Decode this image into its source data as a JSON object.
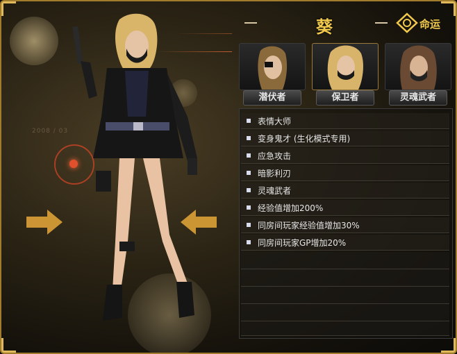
{
  "header": {
    "title": "葵",
    "fate_label": "命运"
  },
  "portraits": [
    {
      "label": "潜伏者",
      "selected": false
    },
    {
      "label": "保卫者",
      "selected": true
    },
    {
      "label": "灵魂武者",
      "selected": false
    }
  ],
  "skills": [
    "表情大师",
    "变身鬼才 (生化模式专用)",
    "应急攻击",
    "暗影利刃",
    "灵魂武者",
    "经验值增加200%",
    "同房间玩家经验值增加30%",
    "同房间玩家GP增加20%"
  ],
  "colors": {
    "accent_gold": "#f0c94d",
    "frame_gold": "#a07c2c",
    "arrow_orange": "#e8a83a"
  }
}
